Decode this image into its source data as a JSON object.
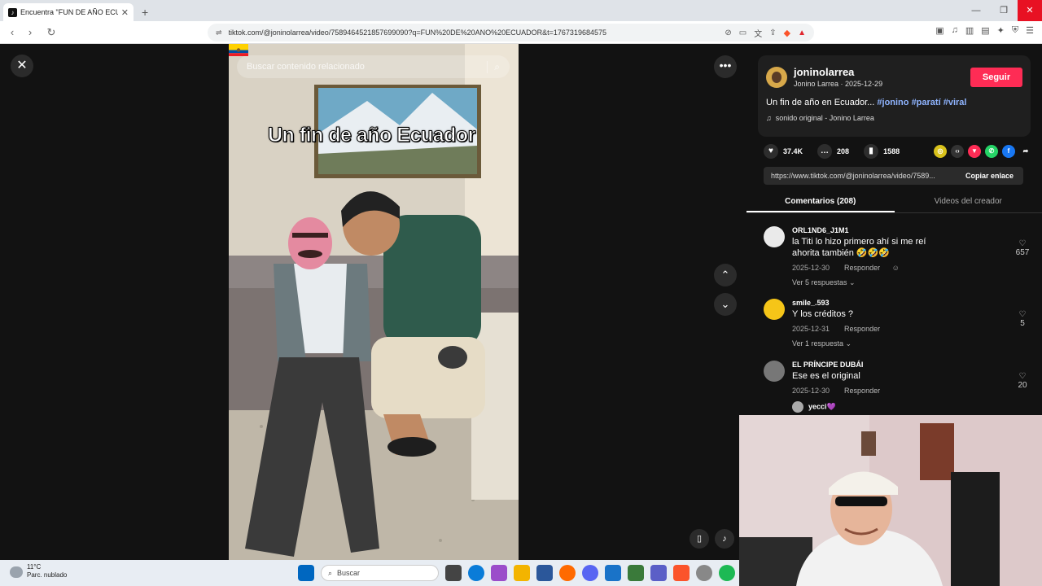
{
  "browser": {
    "tab_title": "Encuentra \"FUN DE AÑO ECU",
    "tab_close": "✕",
    "new_tab": "+",
    "url": "tiktok.com/@joninolarrea/video/7589464521857699090?q=FUN%20DE%20ANO%20ECUADOR&t=1767319684575"
  },
  "video": {
    "search_placeholder": "Buscar contenido relacionado",
    "caption": "Un fin de año Ecuador"
  },
  "post": {
    "username": "joninolarrea",
    "meta": "Jonino Larrea · 2025-12-29",
    "follow_label": "Seguir",
    "description": "Un fin de año en Ecuador...",
    "hashtags": [
      "#jonino",
      "#paratí",
      "#viral"
    ],
    "sound": "sonido original - Jonino Larrea",
    "likes": "37.4K",
    "comments": "208",
    "saves": "1588",
    "link": "https://www.tiktok.com/@joninolarrea/video/7589...",
    "copy_label": "Copiar enlace"
  },
  "tabs": {
    "comments": "Comentarios (208)",
    "creator_videos": "Videos del creador"
  },
  "comments": [
    {
      "user": "ORL1ND6_J1M1",
      "text": "la Titi lo hizo primero ahí si me reí ahorita también 🤣🤣🤣",
      "date": "2025-12-30",
      "reply": "Responder",
      "likes": "657",
      "more": "Ver 5 respuestas ⌄"
    },
    {
      "user": "smile_.593",
      "text": "Y los créditos ?",
      "date": "2025-12-31",
      "reply": "Responder",
      "likes": "5",
      "more": "Ver 1 respuesta ⌄"
    },
    {
      "user": "EL PRÍNCIPE DUBÁI",
      "text": "Ese es el original",
      "date": "2025-12-30",
      "reply": "Responder",
      "likes": "20",
      "more": ""
    }
  ],
  "reply_preview": {
    "user": "yecci💜"
  },
  "taskbar": {
    "temp": "11°C",
    "weather": "Parc. nublado",
    "search": "Buscar"
  },
  "colors": {
    "accent": "#fe2c55",
    "hashtag": "#8fb4ff"
  }
}
